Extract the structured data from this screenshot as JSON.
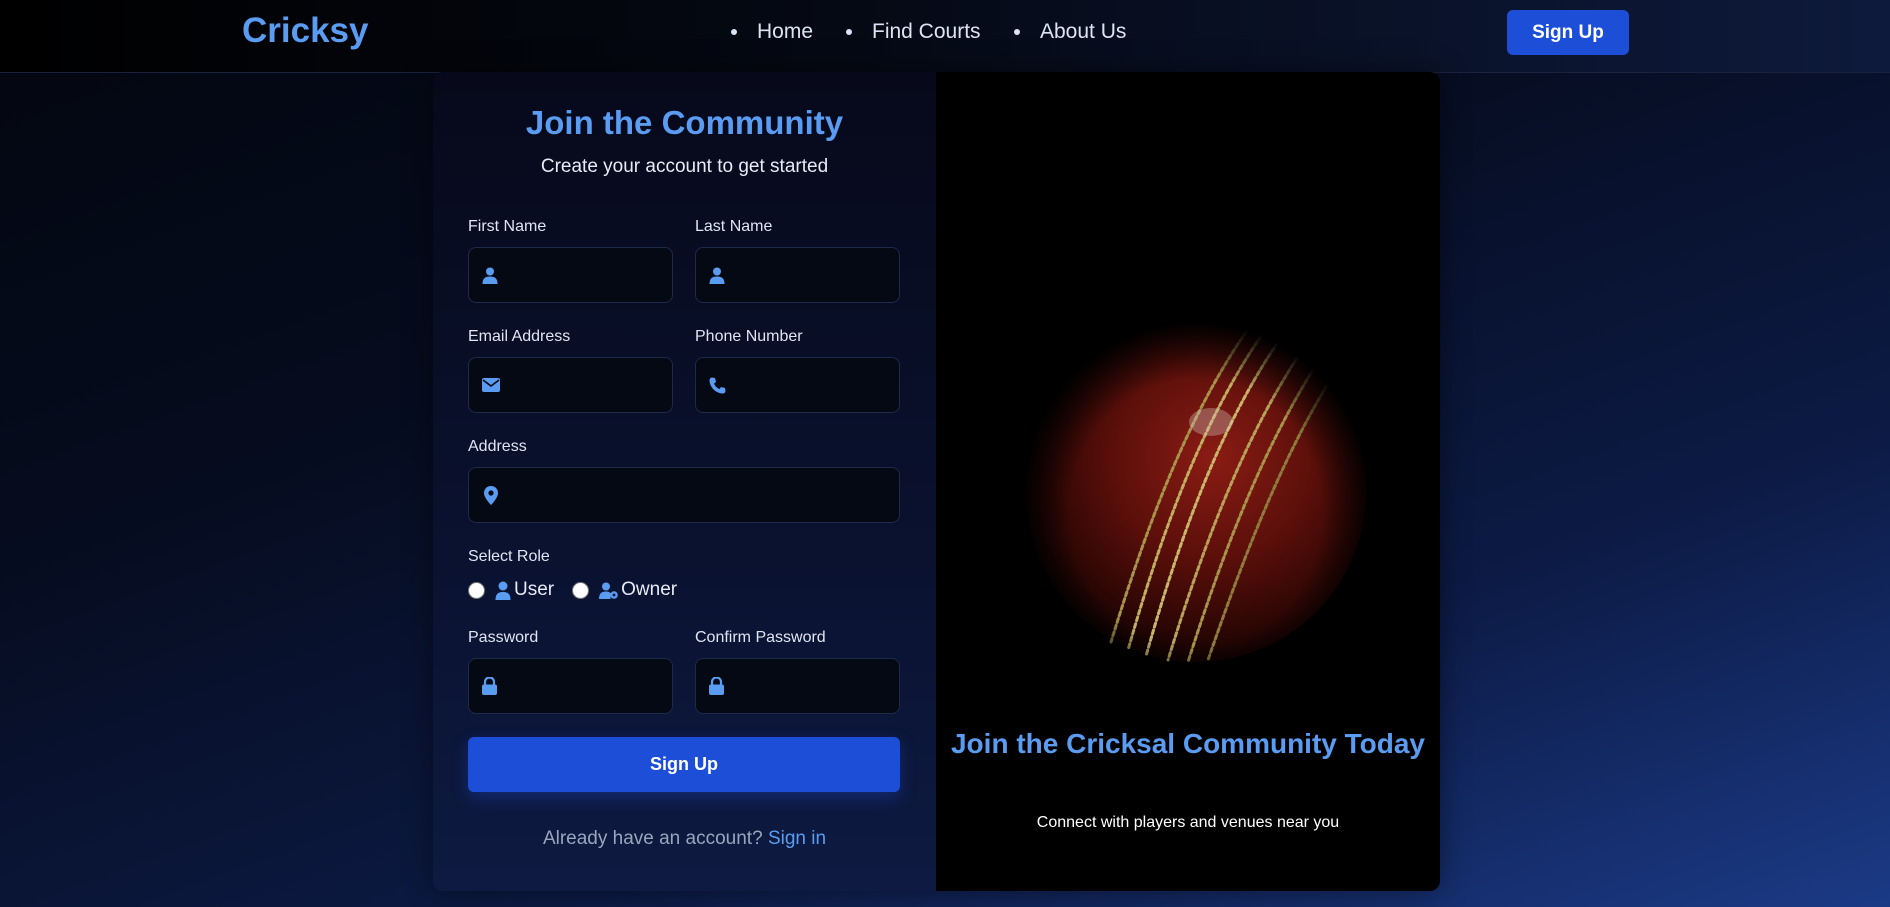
{
  "nav": {
    "logo": "Cricksy",
    "links": [
      "Home",
      "Find Courts",
      "About Us"
    ],
    "signup_label": "Sign Up"
  },
  "form": {
    "title": "Join the Community",
    "subtitle": "Create your account to get started",
    "fields": {
      "first_name": {
        "label": "First Name",
        "icon": "user-icon",
        "value": ""
      },
      "last_name": {
        "label": "Last Name",
        "icon": "user-icon",
        "value": ""
      },
      "email": {
        "label": "Email Address",
        "icon": "envelope-icon",
        "value": ""
      },
      "phone": {
        "label": "Phone Number",
        "icon": "phone-icon",
        "value": ""
      },
      "address": {
        "label": "Address",
        "icon": "map-pin-icon",
        "value": ""
      },
      "password": {
        "label": "Password",
        "icon": "lock-icon",
        "value": ""
      },
      "confirm_password": {
        "label": "Confirm Password",
        "icon": "lock-icon",
        "value": ""
      }
    },
    "role": {
      "label": "Select Role",
      "options": [
        {
          "label": "User",
          "icon": "user-icon",
          "selected": false
        },
        {
          "label": "Owner",
          "icon": "user-gear-icon",
          "selected": false
        }
      ]
    },
    "submit_label": "Sign Up",
    "signin_prompt": "Already have an account?",
    "signin_link": "Sign in"
  },
  "promo": {
    "title": "Join the Cricksal Community Today",
    "subtitle": "Connect with players and venues near you",
    "image": "cricket-ball-image"
  },
  "colors": {
    "accent": "#5a9cf2",
    "button": "#1d4ed8",
    "input_bg": "#050914"
  }
}
